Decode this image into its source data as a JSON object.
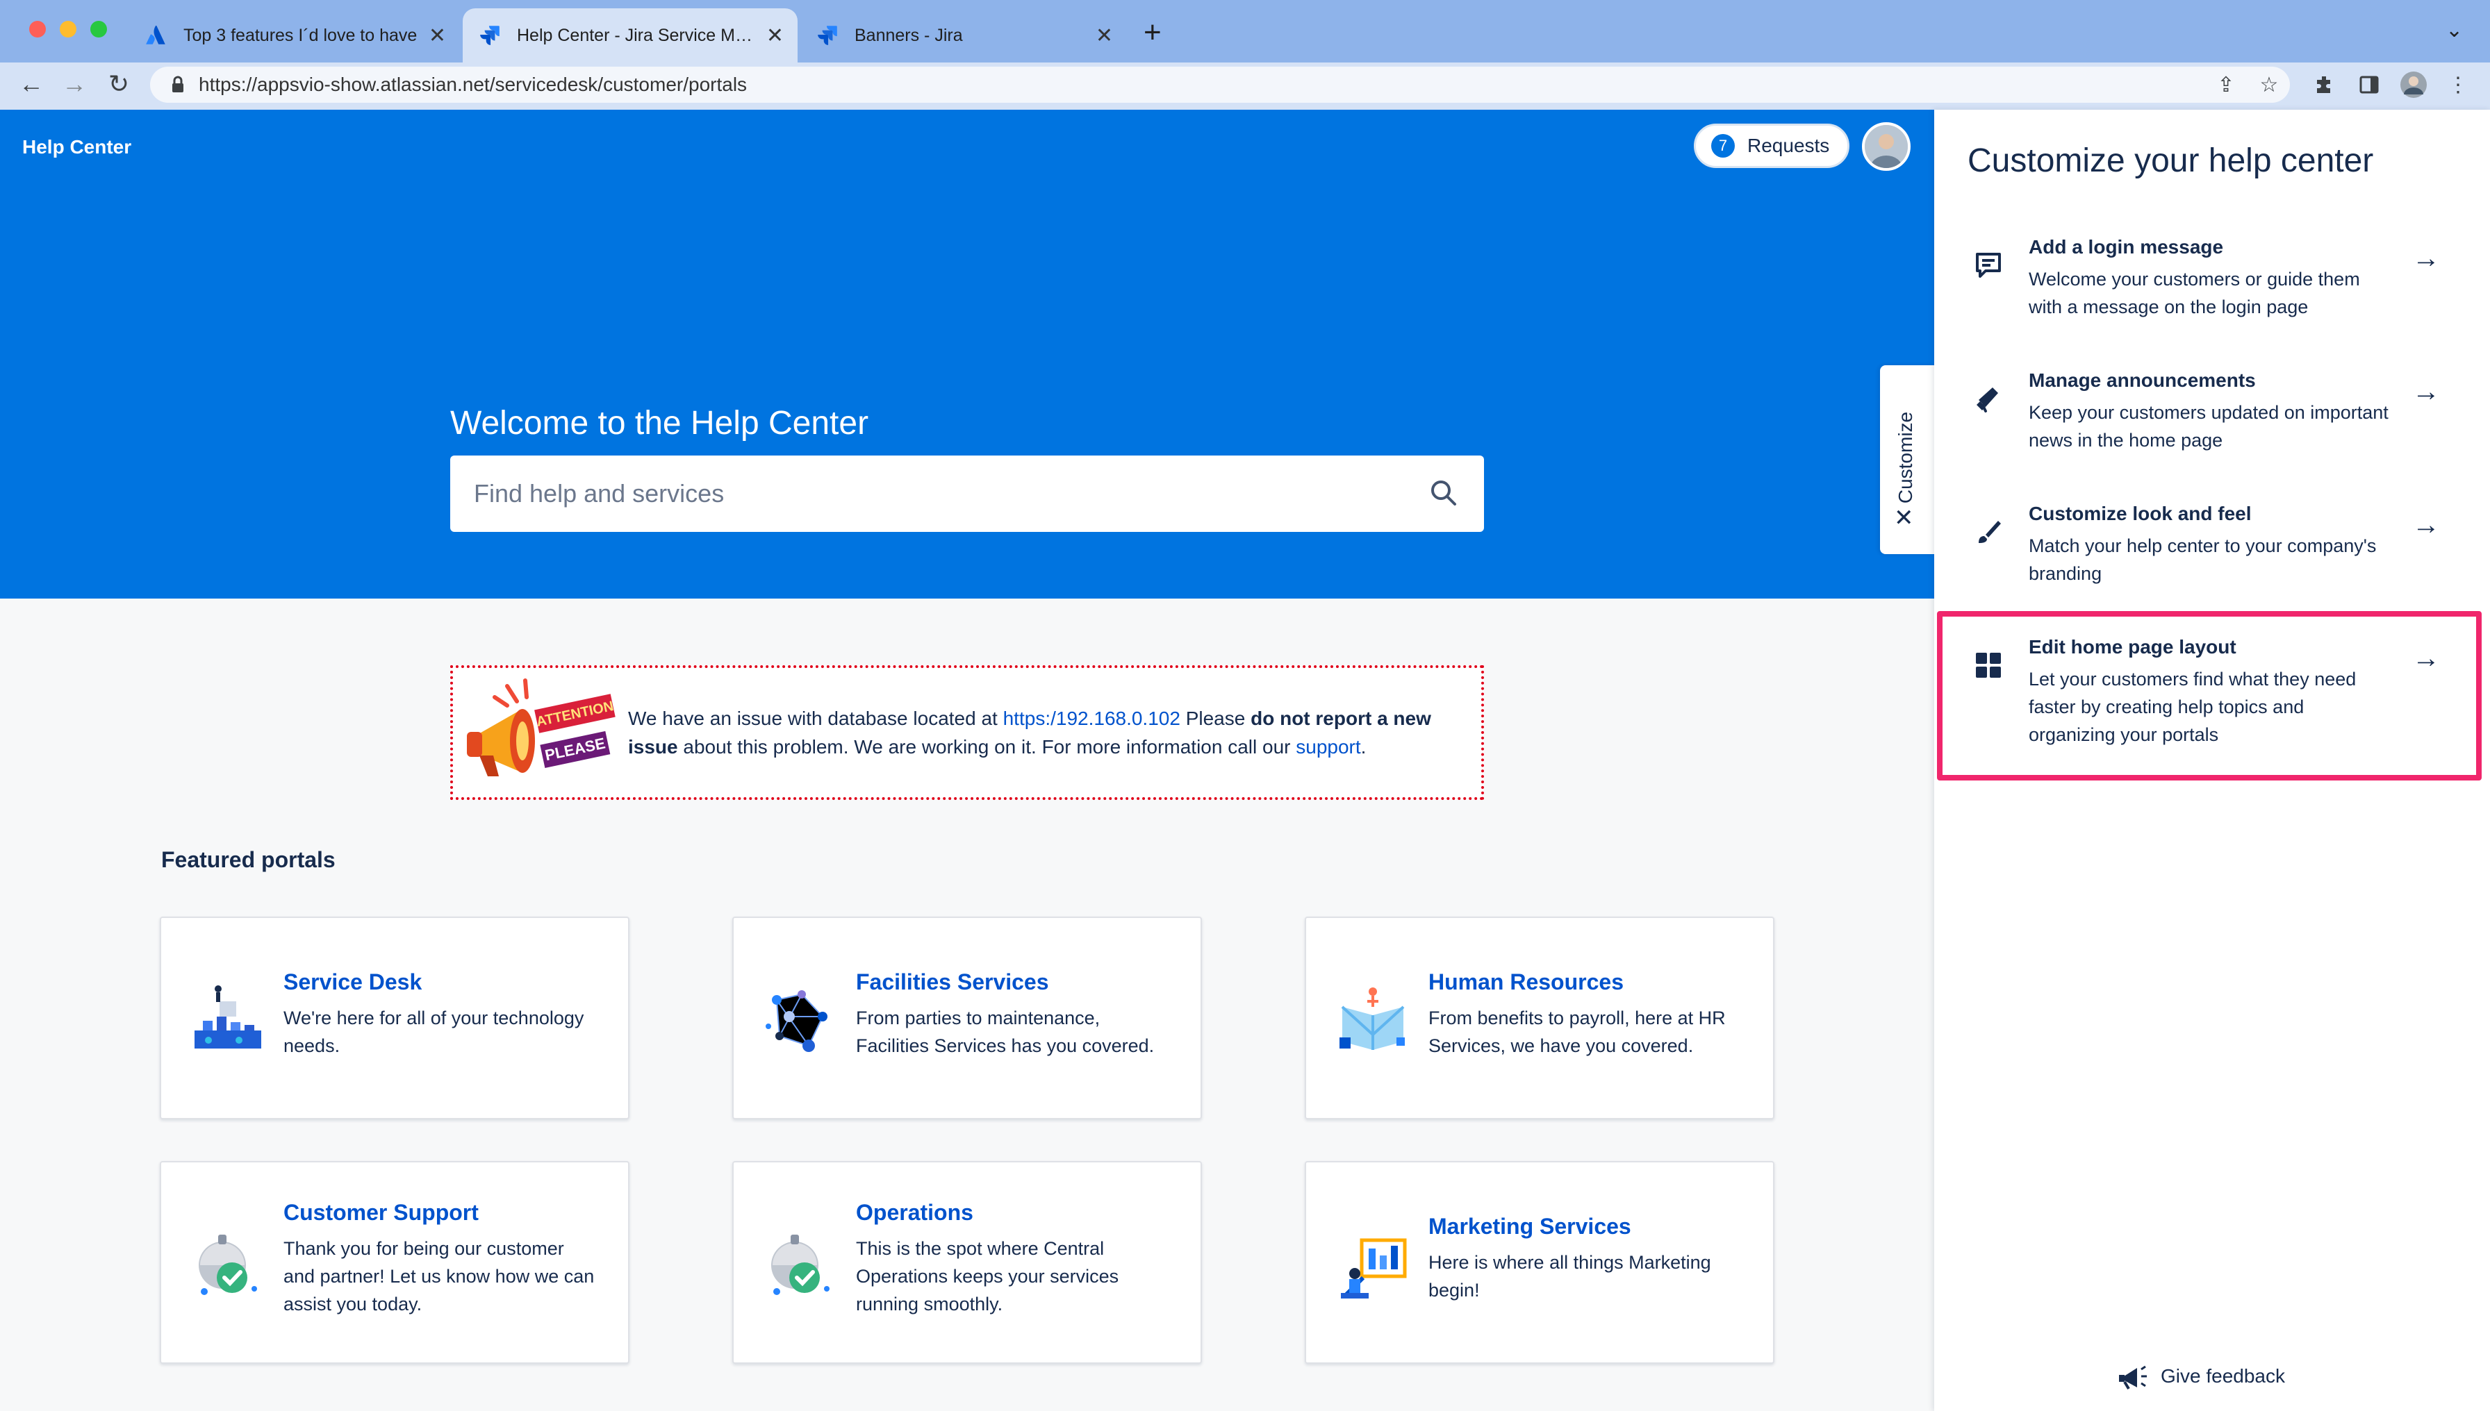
{
  "browser": {
    "tabs": [
      {
        "label": "Top 3 features I´d love to have",
        "icon": "atlassian-icon",
        "active": false
      },
      {
        "label": "Help Center - Jira Service Management",
        "icon": "jira-icon",
        "active": true
      },
      {
        "label": "Banners - Jira",
        "icon": "jira-icon",
        "active": false
      }
    ],
    "close_glyph": "✕",
    "new_tab_glyph": "+",
    "url": "https://appsvio-show.atlassian.net/servicedesk/customer/portals"
  },
  "header": {
    "title": "Help Center",
    "requests_count": "7",
    "requests_label": "Requests"
  },
  "hero": {
    "welcome": "Welcome to the Help Center",
    "search_placeholder": "Find help and services"
  },
  "banner": {
    "image_text_1": "ATTENTION",
    "image_text_2": "PLEASE",
    "text_1": "We have an issue with database located at ",
    "link_1": "https:/192.168.0.102",
    "text_2": " Please ",
    "bold_1": "do not report a new issue",
    "text_3": " about this problem. We are working on it. For more information call our ",
    "link_2": "support",
    "text_4": "."
  },
  "featured": {
    "heading": "Featured portals",
    "portals": [
      {
        "title": "Service Desk",
        "desc": "We're here for all of your technology needs."
      },
      {
        "title": "Facilities Services",
        "desc": "From parties to maintenance, Facilities Services has you covered."
      },
      {
        "title": "Human Resources",
        "desc": "From benefits to payroll, here at HR Services, we have you covered."
      },
      {
        "title": "Customer Support",
        "desc": "Thank you for being our customer and partner! Let us know how we can assist you today."
      },
      {
        "title": "Operations",
        "desc": "This is the spot where Central Operations keeps your services running smoothly."
      },
      {
        "title": "Marketing Services",
        "desc": "Here is where all things Marketing begin!"
      }
    ]
  },
  "customize_tab": {
    "label": "Customize",
    "close_glyph": "✕"
  },
  "panel": {
    "title": "Customize your help center",
    "items": [
      {
        "title": "Add a login message",
        "desc": "Welcome your customers or guide them with a message on the login page",
        "icon": "message-icon"
      },
      {
        "title": "Manage announcements",
        "desc": "Keep your customers updated on important news in the home page",
        "icon": "megaphone-icon"
      },
      {
        "title": "Customize look and feel",
        "desc": "Match your help center to your company's branding",
        "icon": "brush-icon"
      },
      {
        "title": "Edit home page layout",
        "desc": "Let your customers find what they need faster by creating help topics and organizing your portals",
        "icon": "layout-grid-icon"
      }
    ],
    "arrow_glyph": "→",
    "feedback": "Give feedback"
  },
  "colors": {
    "brand_blue": "#0074e0",
    "link_blue": "#0052cc",
    "highlight": "#f0266c",
    "banner_border": "#e0001a"
  }
}
